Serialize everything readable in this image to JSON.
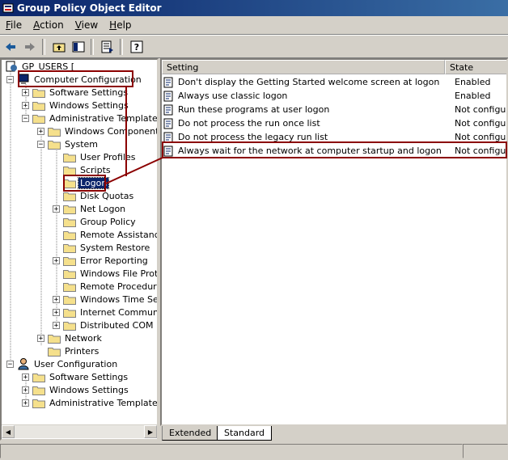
{
  "window": {
    "title": "Group Policy Object Editor"
  },
  "menu": [
    {
      "key": "F",
      "rest": "ile"
    },
    {
      "key": "A",
      "rest": "ction"
    },
    {
      "key": "V",
      "rest": "iew"
    },
    {
      "key": "H",
      "rest": "elp"
    }
  ],
  "tree": {
    "root": "GP_USERS [",
    "computer_configuration": "Computer Configuration",
    "software_settings": "Software Settings",
    "windows_settings": "Windows Settings",
    "administrative_templates": "Administrative Templates",
    "windows_components": "Windows Components",
    "system": "System",
    "user_profiles": "User Profiles",
    "scripts": "Scripts",
    "logon": "Logon",
    "disk_quotas": "Disk Quotas",
    "net_logon": "Net Logon",
    "group_policy": "Group Policy",
    "remote_assistance": "Remote Assistance",
    "system_restore": "System Restore",
    "error_reporting": "Error Reporting",
    "windows_file_protection": "Windows File Prote",
    "remote_procedure": "Remote Procedure",
    "windows_time_service": "Windows Time Serv",
    "internet_communication": "Internet Communic",
    "distributed_com": "Distributed COM",
    "network": "Network",
    "printers": "Printers",
    "user_configuration": "User Configuration",
    "user_software_settings": "Software Settings",
    "user_windows_settings": "Windows Settings",
    "user_administrative_templates": "Administrative Templates"
  },
  "columns": {
    "setting": "Setting",
    "state": "State"
  },
  "policies": [
    {
      "setting": "Don't display the Getting Started welcome screen at logon",
      "state": "Enabled"
    },
    {
      "setting": "Always use classic logon",
      "state": "Enabled"
    },
    {
      "setting": "Run these programs at user logon",
      "state": "Not configure"
    },
    {
      "setting": "Do not process the run once list",
      "state": "Not configure"
    },
    {
      "setting": "Do not process the legacy run list",
      "state": "Not configure"
    },
    {
      "setting": "Always wait for the network at computer startup and logon",
      "state": "Not configure"
    }
  ],
  "tabs": {
    "extended": "Extended",
    "standard": "Standard"
  },
  "colors": {
    "highlight": "#8b0000",
    "title_start": "#0a246a",
    "title_end": "#3a6ea5"
  }
}
